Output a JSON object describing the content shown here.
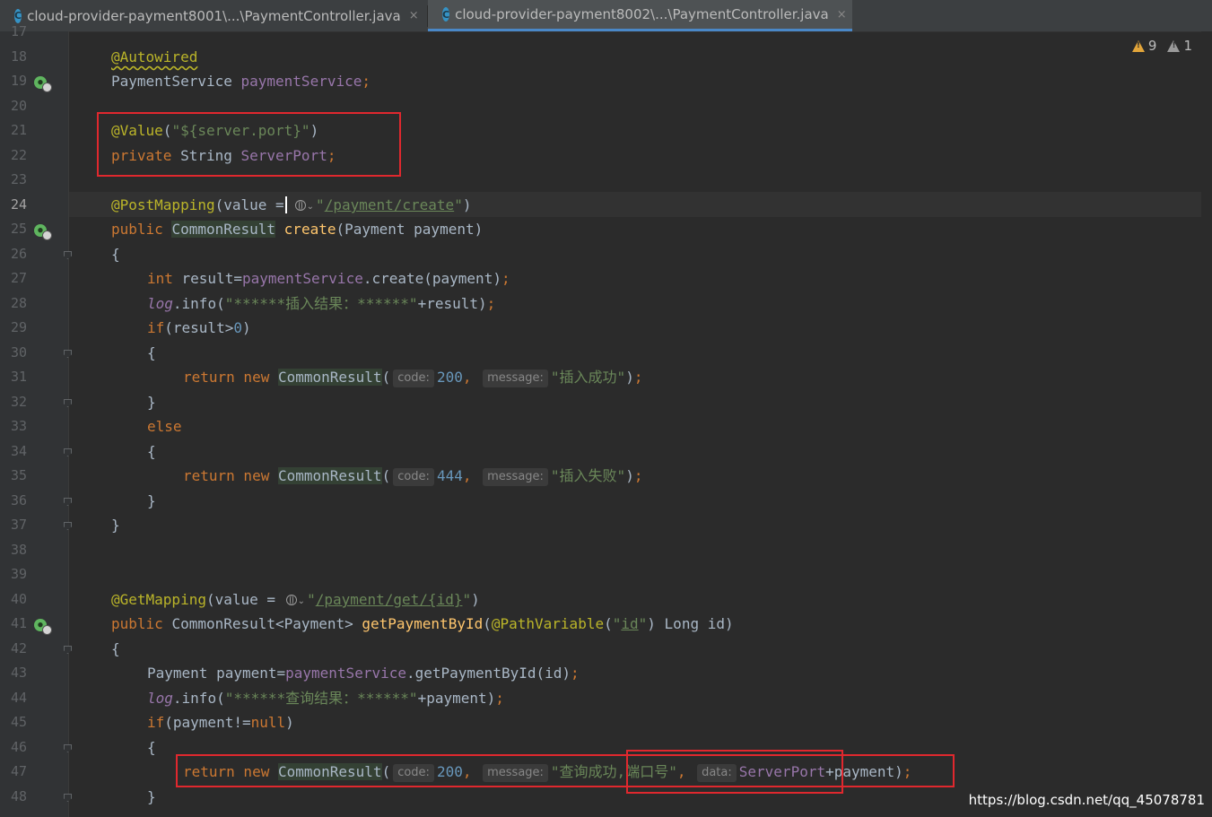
{
  "tabs": [
    {
      "title": "cloud-provider-payment8001\\...\\PaymentController.java",
      "icon": "C",
      "close": "×"
    },
    {
      "title": "cloud-provider-payment8002\\...\\PaymentController.java",
      "icon": "C",
      "close": "×"
    }
  ],
  "warnings": {
    "warning_count": "9",
    "weak_warning_count": "1"
  },
  "line_numbers": [
    "17",
    "18",
    "19",
    "20",
    "21",
    "22",
    "23",
    "24",
    "25",
    "26",
    "27",
    "28",
    "29",
    "30",
    "31",
    "32",
    "33",
    "34",
    "35",
    "36",
    "37",
    "38",
    "39",
    "40",
    "41",
    "42",
    "43",
    "44",
    "45",
    "46",
    "47",
    "48"
  ],
  "code": {
    "l18": {
      "anno": "@Autowired"
    },
    "l19": {
      "type": "PaymentService ",
      "field": "paymentService",
      "semi": ";"
    },
    "l21": {
      "anno": "@Value",
      "open": "(",
      "str": "\"${server.port}\"",
      "close": ")"
    },
    "l22": {
      "kw": "private ",
      "type": "String ",
      "field": "ServerPort",
      "semi": ";"
    },
    "l24": {
      "anno": "@PostMapping",
      "pre": "(value =",
      "q1": "\"",
      "path": "/payment/create",
      "q2": "\"",
      "close": ")"
    },
    "l25": {
      "kw": "public ",
      "type": "CommonResult",
      "sp": " ",
      "fn": "create",
      "args": "(Payment payment)"
    },
    "l26": {
      "text": "{"
    },
    "l27": {
      "kw": "int ",
      "a": "result=",
      "field": "paymentService",
      "b": ".create(payment)",
      "semi": ";"
    },
    "l28": {
      "log": "log",
      "a": ".info(",
      "str": "\"******插入结果：******\"",
      "b": "+result)",
      "semi": ";"
    },
    "l29": {
      "kw": "if",
      "a": "(result>",
      "num": "0",
      "b": ")"
    },
    "l30": {
      "text": "{"
    },
    "l31": {
      "kw": "return new ",
      "cls": "CommonResult",
      "open": "(",
      "h1": "code:",
      "n1": "200",
      "comma1": ", ",
      "h2": "message:",
      "str": "\"插入成功\"",
      "close": ")",
      "semi": ";"
    },
    "l32": {
      "text": "}"
    },
    "l33": {
      "kw": "else"
    },
    "l34": {
      "text": "{"
    },
    "l35": {
      "kw": "return new ",
      "cls": "CommonResult",
      "open": "(",
      "h1": "code:",
      "n1": "444",
      "comma1": ", ",
      "h2": "message:",
      "str": "\"插入失败\"",
      "close": ")",
      "semi": ";"
    },
    "l36": {
      "text": "}"
    },
    "l37": {
      "text": "}"
    },
    "l40": {
      "anno": "@GetMapping",
      "pre": "(value = ",
      "q1": "\"",
      "path": "/payment/get/{id}",
      "q2": "\"",
      "close": ")"
    },
    "l41": {
      "kw": "public ",
      "type": "CommonResult<Payment> ",
      "fn": "getPaymentById",
      "open": "(",
      "anno": "@PathVariable",
      "a": "(",
      "str1": "\"",
      "id": "id",
      "str2": "\"",
      "b": ") Long id)"
    },
    "l42": {
      "text": "{"
    },
    "l43": {
      "a": "Payment payment=",
      "field": "paymentService",
      "b": ".getPaymentById(id)",
      "semi": ";"
    },
    "l44": {
      "log": "log",
      "a": ".info(",
      "str": "\"******查询结果：******\"",
      "b": "+payment)",
      "semi": ";"
    },
    "l45": {
      "kw": "if",
      "a": "(payment!=",
      "kw2": "null",
      "b": ")"
    },
    "l46": {
      "text": "{"
    },
    "l47": {
      "kw": "return new ",
      "cls": "CommonResult",
      "open": "(",
      "h1": "code:",
      "n1": "200",
      "comma1": ", ",
      "h2": "message:",
      "str": "\"查询成功,端口号\"",
      "comma2": ", ",
      "h3": "data:",
      "field": "ServerPort",
      "b": "+payment)",
      "semi": ";"
    },
    "l48": {
      "text": "}"
    }
  },
  "watermark": "https://blog.csdn.net/qq_45078781",
  "colors": {
    "keyword": "#cc7832",
    "annotation": "#bbb529",
    "string": "#6a8759",
    "field": "#9876aa",
    "number": "#6897bb",
    "method": "#ffc66d",
    "highlight_box": "#e0282e"
  }
}
